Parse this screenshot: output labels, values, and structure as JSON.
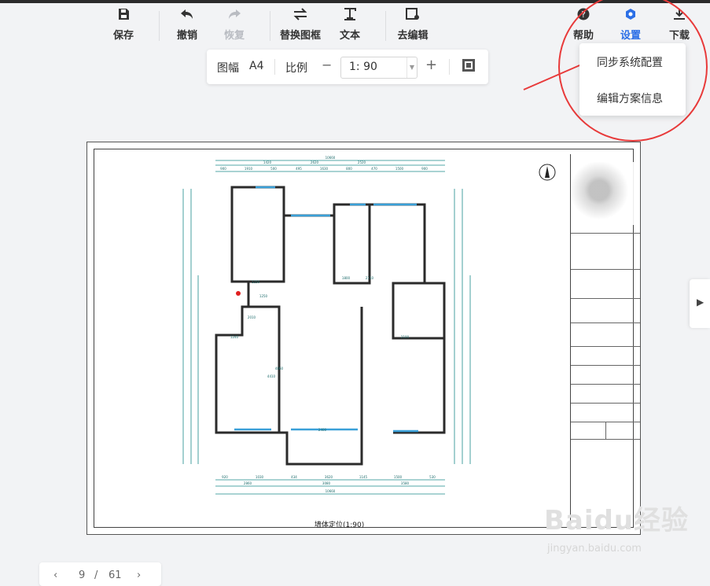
{
  "toolbar": {
    "save": "保存",
    "undo": "撤销",
    "redo": "恢复",
    "replace_frame": "替换图框",
    "text": "文本",
    "go_edit": "去编辑",
    "help": "帮助",
    "settings": "设置",
    "download": "下载"
  },
  "scalebar": {
    "paper_label": "图幅",
    "paper_value": "A4",
    "scale_label": "比例",
    "minus": "−",
    "scale_value": "1:  90",
    "plus": "+"
  },
  "settings_menu": {
    "items": [
      "同步系统配置",
      "编辑方案信息"
    ]
  },
  "drawing": {
    "caption": "墙体定位(1:90)",
    "dim_top_total": "10660",
    "dim_bottom_total": "10660",
    "dims_top_row1": [
      "1420",
      "2620",
      "2520"
    ],
    "dims_top_row2": [
      "900",
      "1910",
      "500",
      "495",
      "1630",
      "800",
      "470",
      "1500",
      "900"
    ],
    "dims_bottom_row1": [
      "920",
      "1030",
      "434",
      "3620",
      "1145",
      "1500",
      "530"
    ],
    "dims_bottom_row2": [
      "2860",
      "3080",
      "3580"
    ],
    "room_dims": [
      "1250",
      "1800",
      "2110",
      "1250",
      "2100",
      "2400",
      "4860",
      "1240",
      "2010",
      "4410"
    ]
  },
  "pager": {
    "prev": "‹",
    "current": "9",
    "sep": "/",
    "total": "61",
    "next": "›"
  },
  "watermark": {
    "main": "Baidu经验",
    "sub": "jingyan.baidu.com"
  },
  "colors": {
    "accent": "#2c6fe6",
    "annotation": "#e83a3a",
    "dimension": "#1a8a8a",
    "window": "#3aa0d8"
  }
}
